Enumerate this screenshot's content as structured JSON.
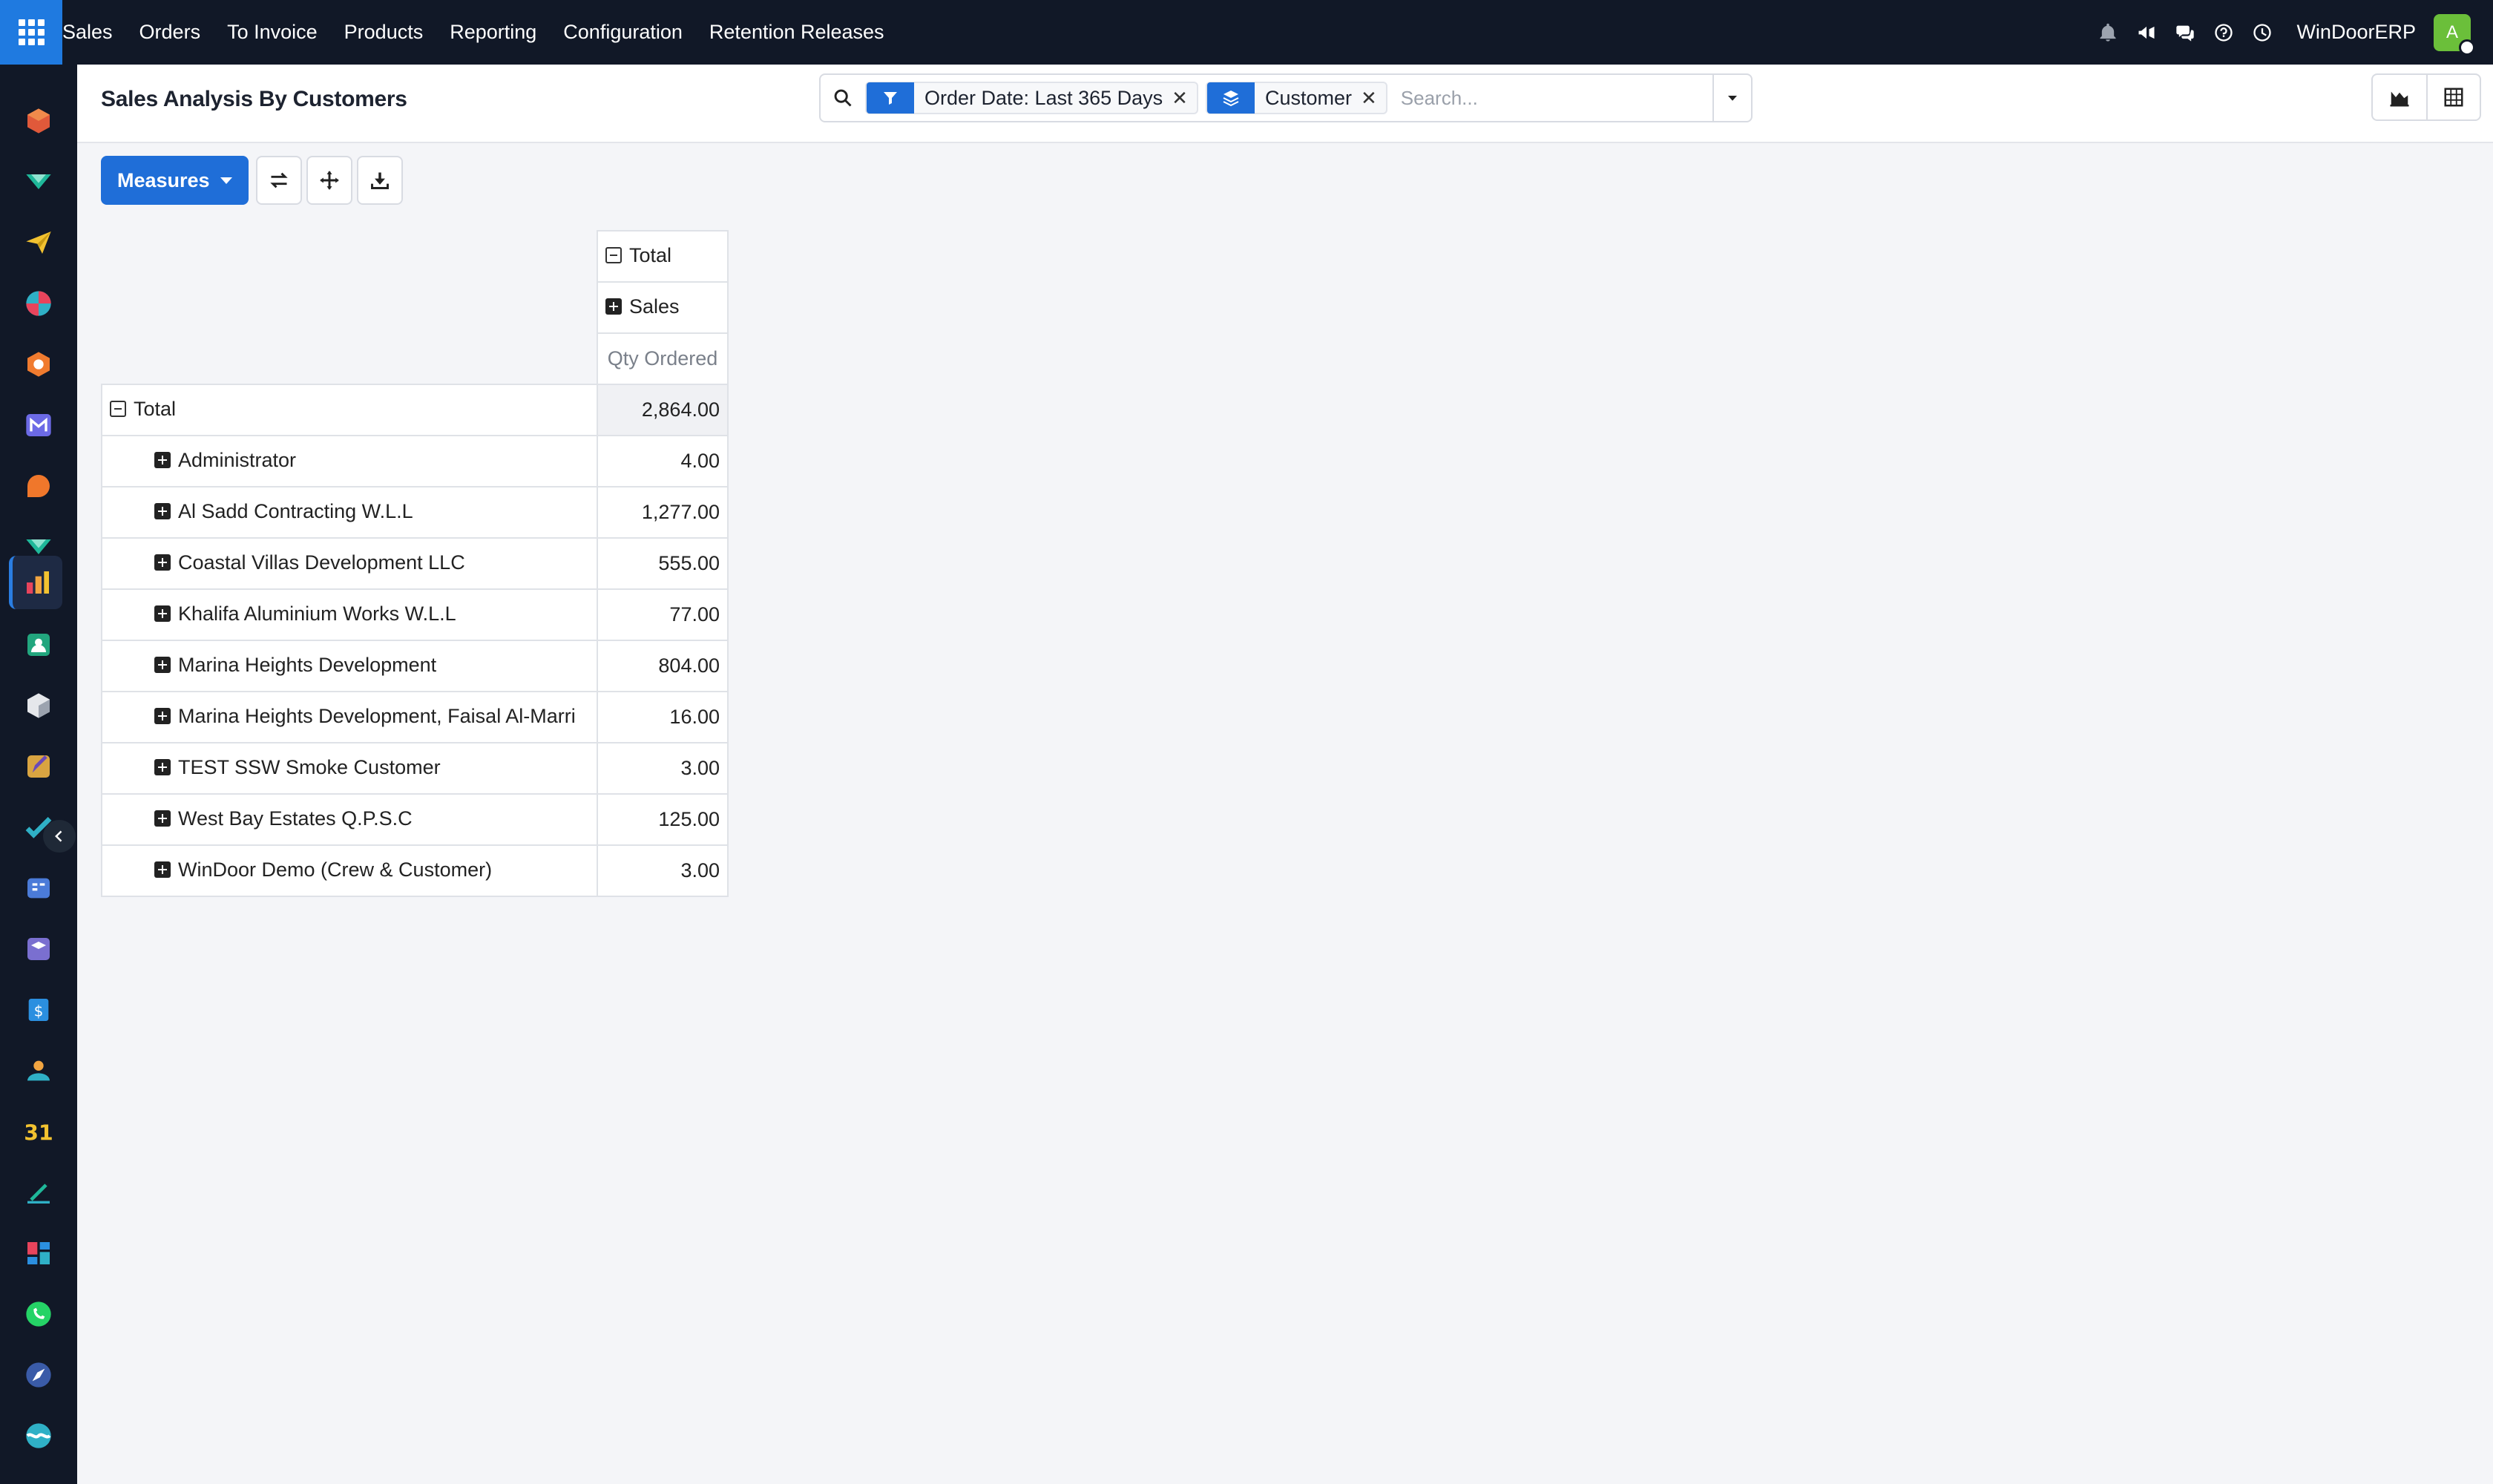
{
  "navbar": {
    "menu": [
      "Sales",
      "Orders",
      "To Invoice",
      "Products",
      "Reporting",
      "Configuration",
      "Retention Releases"
    ],
    "company": "WinDoorERP",
    "avatar_initial": "A",
    "icons": [
      "bell-icon",
      "megaphone-icon",
      "chat-icon",
      "help-icon",
      "clock-icon"
    ]
  },
  "sidebar": {
    "apps": [
      "app-1",
      "app-2",
      "app-3",
      "app-4",
      "app-5",
      "app-6",
      "app-7",
      "app-8",
      "app-sales-active",
      "app-10",
      "app-11",
      "app-12",
      "app-13",
      "app-14",
      "app-15",
      "app-16",
      "app-17",
      "app-calendar",
      "app-19",
      "app-20",
      "app-whatsapp",
      "app-22",
      "app-23"
    ],
    "calendar_label": "31"
  },
  "control": {
    "title": "Sales Analysis By Customers",
    "facets": [
      {
        "type": "filter",
        "label": "Order Date: Last 365 Days"
      },
      {
        "type": "groupby",
        "label": "Customer"
      }
    ],
    "search_placeholder": "Search..."
  },
  "actions": {
    "measures_label": "Measures"
  },
  "pivot": {
    "col_total": "Total",
    "col_group": "Sales",
    "measure": "Qty Ordered",
    "row_total_label": "Total",
    "row_total_value": "2,864.00",
    "rows": [
      {
        "label": "Administrator",
        "value": "4.00"
      },
      {
        "label": "Al Sadd Contracting W.L.L",
        "value": "1,277.00"
      },
      {
        "label": "Coastal Villas Development LLC",
        "value": "555.00"
      },
      {
        "label": "Khalifa Aluminium Works W.L.L",
        "value": "77.00"
      },
      {
        "label": "Marina Heights Development",
        "value": "804.00"
      },
      {
        "label": "Marina Heights Development, Faisal Al-Marri",
        "value": "16.00"
      },
      {
        "label": "TEST SSW Smoke Customer",
        "value": "3.00"
      },
      {
        "label": "West Bay Estates Q.P.S.C",
        "value": "125.00"
      },
      {
        "label": "WinDoor Demo (Crew & Customer)",
        "value": "3.00"
      }
    ]
  },
  "colors": {
    "navbar_bg": "#111827",
    "accent": "#1f6ed8",
    "avatar": "#6bbf3a"
  }
}
